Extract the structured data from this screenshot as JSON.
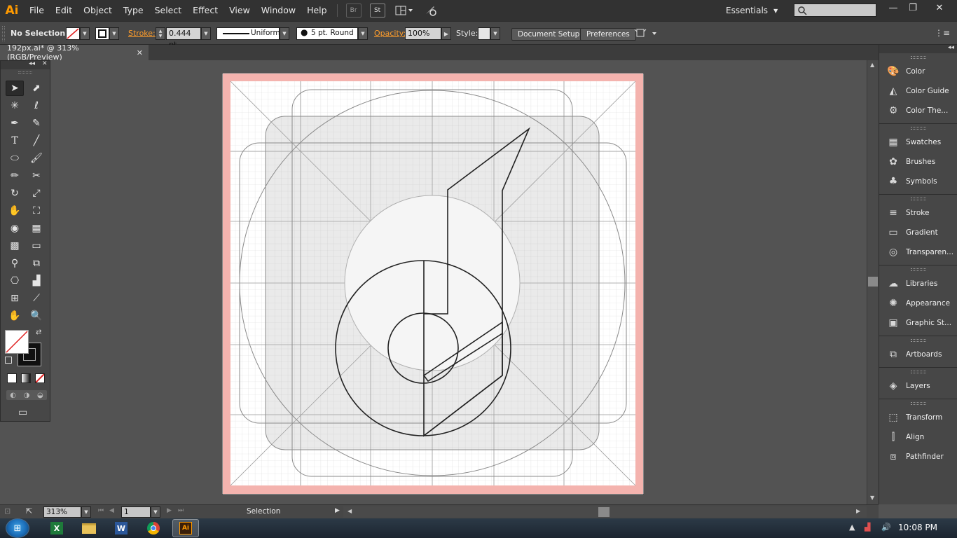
{
  "app": {
    "logo": "Ai"
  },
  "menu": [
    "File",
    "Edit",
    "Object",
    "Type",
    "Select",
    "Effect",
    "View",
    "Window",
    "Help"
  ],
  "menubar_icons": {
    "bridge": "Br",
    "stock": "St"
  },
  "workspace": {
    "label": "Essentials"
  },
  "window_controls": {
    "minimize": "—",
    "restore": "❐",
    "close": "✕"
  },
  "control": {
    "selection_status": "No Selection",
    "stroke_label": "Stroke:",
    "stroke_value": "0.444 pt",
    "profile": "Uniform",
    "brush": "5 pt. Round",
    "opacity_label": "Opacity:",
    "opacity_value": "100%",
    "style_label": "Style:",
    "document_setup": "Document Setup",
    "preferences": "Preferences"
  },
  "document": {
    "tab_title": "192px.ai* @ 313% (RGB/Preview)",
    "close": "✕"
  },
  "toolbox": {
    "tools": [
      "selection-tool-icon",
      "direct-selection-tool-icon",
      "magic-wand-tool-icon",
      "lasso-tool-icon",
      "pen-tool-icon",
      "curvature-tool-icon",
      "type-tool-icon",
      "line-segment-tool-icon",
      "ellipse-tool-icon",
      "paintbrush-tool-icon",
      "pencil-tool-icon",
      "scissors-tool-icon",
      "rotate-tool-icon",
      "scale-tool-icon",
      "puppet-warp-tool-icon",
      "free-transform-tool-icon",
      "shape-builder-tool-icon",
      "perspective-grid-tool-icon",
      "mesh-tool-icon",
      "gradient-tool-icon",
      "eyedropper-tool-icon",
      "blend-tool-icon",
      "symbol-sprayer-tool-icon",
      "column-graph-tool-icon",
      "artboard-tool-icon",
      "slice-tool-icon",
      "hand-tool-icon",
      "zoom-tool-icon"
    ]
  },
  "panels": {
    "groups": [
      [
        {
          "label": "Color",
          "icon": "color-palette-icon"
        },
        {
          "label": "Color Guide",
          "icon": "color-guide-icon"
        },
        {
          "label": "Color The...",
          "icon": "color-themes-icon"
        }
      ],
      [
        {
          "label": "Swatches",
          "icon": "swatches-icon"
        },
        {
          "label": "Brushes",
          "icon": "brushes-icon"
        },
        {
          "label": "Symbols",
          "icon": "symbols-icon"
        }
      ],
      [
        {
          "label": "Stroke",
          "icon": "stroke-icon"
        },
        {
          "label": "Gradient",
          "icon": "gradient-icon"
        },
        {
          "label": "Transparen...",
          "icon": "transparency-icon"
        }
      ],
      [
        {
          "label": "Libraries",
          "icon": "libraries-icon"
        },
        {
          "label": "Appearance",
          "icon": "appearance-icon"
        },
        {
          "label": "Graphic St...",
          "icon": "graphic-styles-icon"
        }
      ],
      [
        {
          "label": "Artboards",
          "icon": "artboards-icon"
        }
      ],
      [
        {
          "label": "Layers",
          "icon": "layers-icon"
        }
      ],
      [
        {
          "label": "Transform",
          "icon": "transform-icon"
        },
        {
          "label": "Align",
          "icon": "align-icon"
        },
        {
          "label": "Pathfinder",
          "icon": "pathfinder-icon"
        }
      ]
    ]
  },
  "status": {
    "zoom": "313%",
    "artboard": "1",
    "tool": "Selection"
  },
  "taskbar": {
    "time": "10:08 PM",
    "apps": [
      "excel-icon",
      "file-explorer-icon",
      "word-icon",
      "chrome-icon",
      "illustrator-icon"
    ]
  },
  "colors": {
    "accent_orange": "#ff9a00",
    "bleed_pink": "#f4b3ae",
    "artboard_white": "#ffffff"
  }
}
